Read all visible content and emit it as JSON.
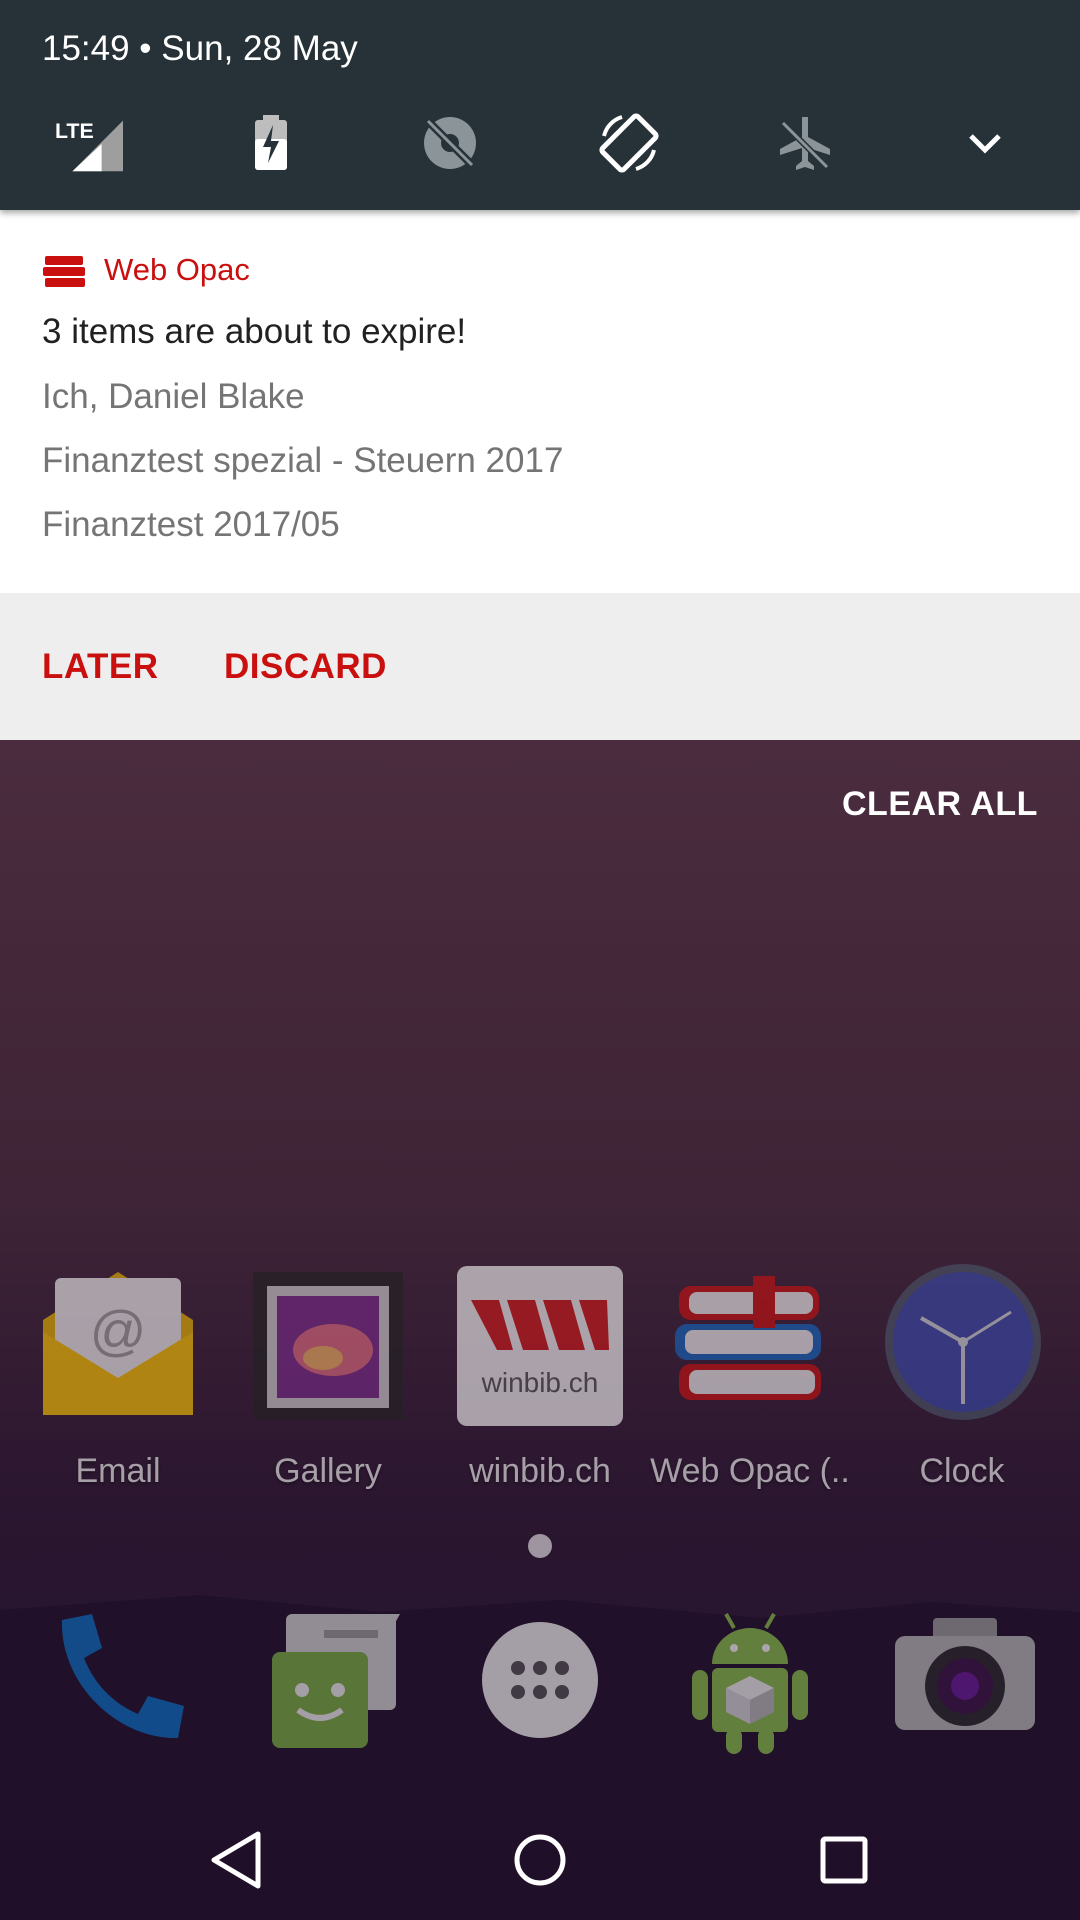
{
  "status": {
    "time_date": "15:49  •  Sun, 28 May",
    "network": "LTE"
  },
  "quick_settings": {
    "icons": [
      "lte-signal-icon",
      "battery-charging-icon",
      "location-off-icon",
      "auto-rotate-icon",
      "airplane-mode-icon",
      "expand-chevron-icon"
    ]
  },
  "notification": {
    "app_name": "Web Opac",
    "title": "3 items are about to expire!",
    "lines": [
      "Ich, Daniel Blake",
      "Finanztest spezial - Steuern 2017",
      "Finanztest 2017/05"
    ],
    "actions": [
      "LATER",
      "DISCARD"
    ],
    "accent_color": "#c9100f"
  },
  "clear_all": "CLEAR ALL",
  "home": {
    "apps": [
      {
        "label": "Email",
        "icon": "email-icon"
      },
      {
        "label": "Gallery",
        "icon": "gallery-icon"
      },
      {
        "label": "winbib.ch",
        "icon": "winbib-icon",
        "logo_text": "winbib.ch"
      },
      {
        "label": "Web Opac (..",
        "icon": "web-opac-icon"
      },
      {
        "label": "Clock",
        "icon": "clock-icon"
      }
    ],
    "dock": [
      "phone-icon",
      "messaging-icon",
      "app-drawer-icon",
      "android-icon",
      "camera-icon"
    ]
  },
  "navigation": [
    "back-button",
    "home-button",
    "recents-button"
  ]
}
